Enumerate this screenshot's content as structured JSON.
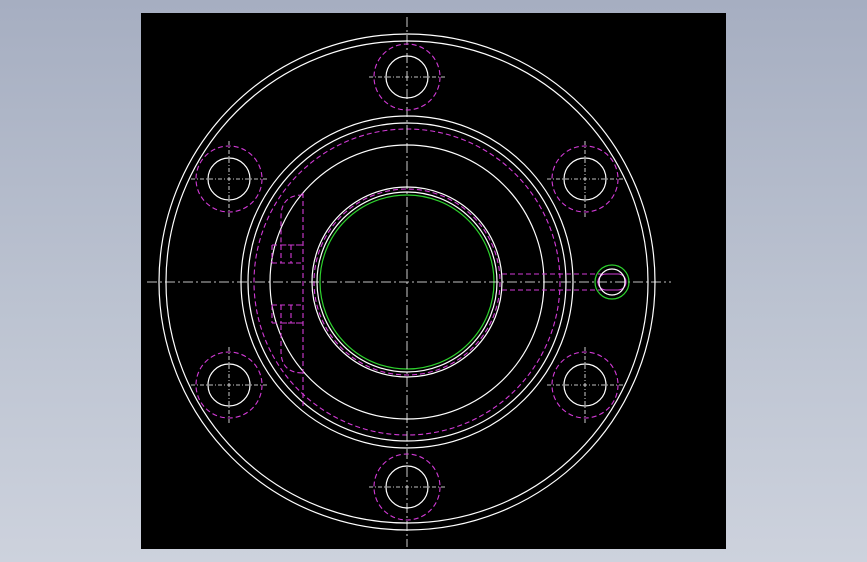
{
  "colors": {
    "background_gradient_top": "#a6aec1",
    "background_gradient_bottom": "#cdd2dd",
    "viewport": "#000000",
    "outline": "#ffffff",
    "hidden_line": "#d23ad6",
    "highlight": "#2ed12e"
  },
  "drawing": {
    "view": "front",
    "features": [
      "outer-flange",
      "bolt-holes",
      "center-bore",
      "hidden-pocket",
      "side-port"
    ]
  }
}
